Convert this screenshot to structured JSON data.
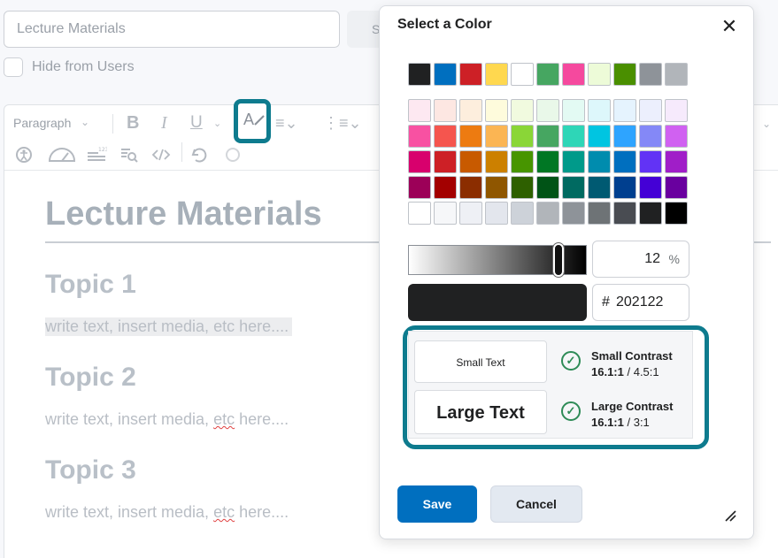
{
  "background": {
    "title_input_value": "Lecture Materials",
    "ghost_button_label": "S",
    "hide_label": "Hide from Users",
    "toolbar": {
      "paragraph_label": "Paragraph",
      "bold": "B",
      "italic": "I",
      "underline": "U",
      "text_color_glyph": "A"
    },
    "content": {
      "h1": "Lecture Materials",
      "sections": [
        {
          "heading": "Topic 1",
          "text_before": "write text, insert media, ",
          "text_squig": "etc",
          "text_after": " here...."
        },
        {
          "heading": "Topic 2",
          "text_before": "write text, insert media, ",
          "text_squig": "etc",
          "text_after": " here...."
        },
        {
          "heading": "Topic 3",
          "text_before": "write text, insert media, ",
          "text_squig": "etc",
          "text_after": " here...."
        }
      ]
    }
  },
  "dialog": {
    "title": "Select a Color",
    "close_icon": "close-icon",
    "swatches": {
      "top_row": [
        "#202122",
        "#006fbf",
        "#cd2026",
        "#ffd84f",
        "#ffffff",
        "#46a661",
        "#f5499e",
        "#edfbd8",
        "#4a8f00",
        "#8e9399",
        "#b1b5ba"
      ],
      "grid": [
        [
          "#fde8f1",
          "#fde7e2",
          "#fdeedd",
          "#fefbdc",
          "#f1fadf",
          "#e9f8e9",
          "#e3faf3",
          "#ddf7fb",
          "#e5f3fe",
          "#eceffd",
          "#f6eafc"
        ],
        [
          "#f851a2",
          "#f5554e",
          "#ed7b11",
          "#fbb553",
          "#8ad637",
          "#46a661",
          "#2ed6b7",
          "#00c5e1",
          "#2ea4ff",
          "#8488f7",
          "#d061f1"
        ],
        [
          "#d8006d",
          "#cd2026",
          "#c85a00",
          "#cc8000",
          "#479500",
          "#007724",
          "#009a8a",
          "#008cae",
          "#006fbf",
          "#6233f5",
          "#a01ec8"
        ],
        [
          "#9c0058",
          "#a30000",
          "#8b2d00",
          "#8f5600",
          "#2e6000",
          "#005316",
          "#006a61",
          "#005a72",
          "#003f8f",
          "#4400d6",
          "#69009f"
        ],
        [
          "#ffffff",
          "#f6f7f9",
          "#eef0f5",
          "#e3e6ed",
          "#cdd2d9",
          "#b1b5ba",
          "#8e9399",
          "#6e7376",
          "#494c52",
          "#202122",
          "#000000"
        ]
      ]
    },
    "lightness": {
      "percent": "12",
      "percent_symbol": "%",
      "level": 0.88
    },
    "current_color": "#202122",
    "hex": {
      "hash": "#",
      "value": "202122"
    },
    "contrast": {
      "small_sample": "Small Text",
      "large_sample": "Large Text",
      "small_label": "Small Contrast",
      "small_ratio": "16.1:1",
      "small_required": " / 4.5:1",
      "large_label": "Large Contrast",
      "large_ratio": "16.1:1",
      "large_required": " / 3:1",
      "check_icon": "check-circle-icon",
      "pass_color": "#2e8b57"
    },
    "save_label": "Save",
    "cancel_label": "Cancel",
    "resize_icon": "resize-handle-icon"
  },
  "highlight_color": "#0e7b8e"
}
